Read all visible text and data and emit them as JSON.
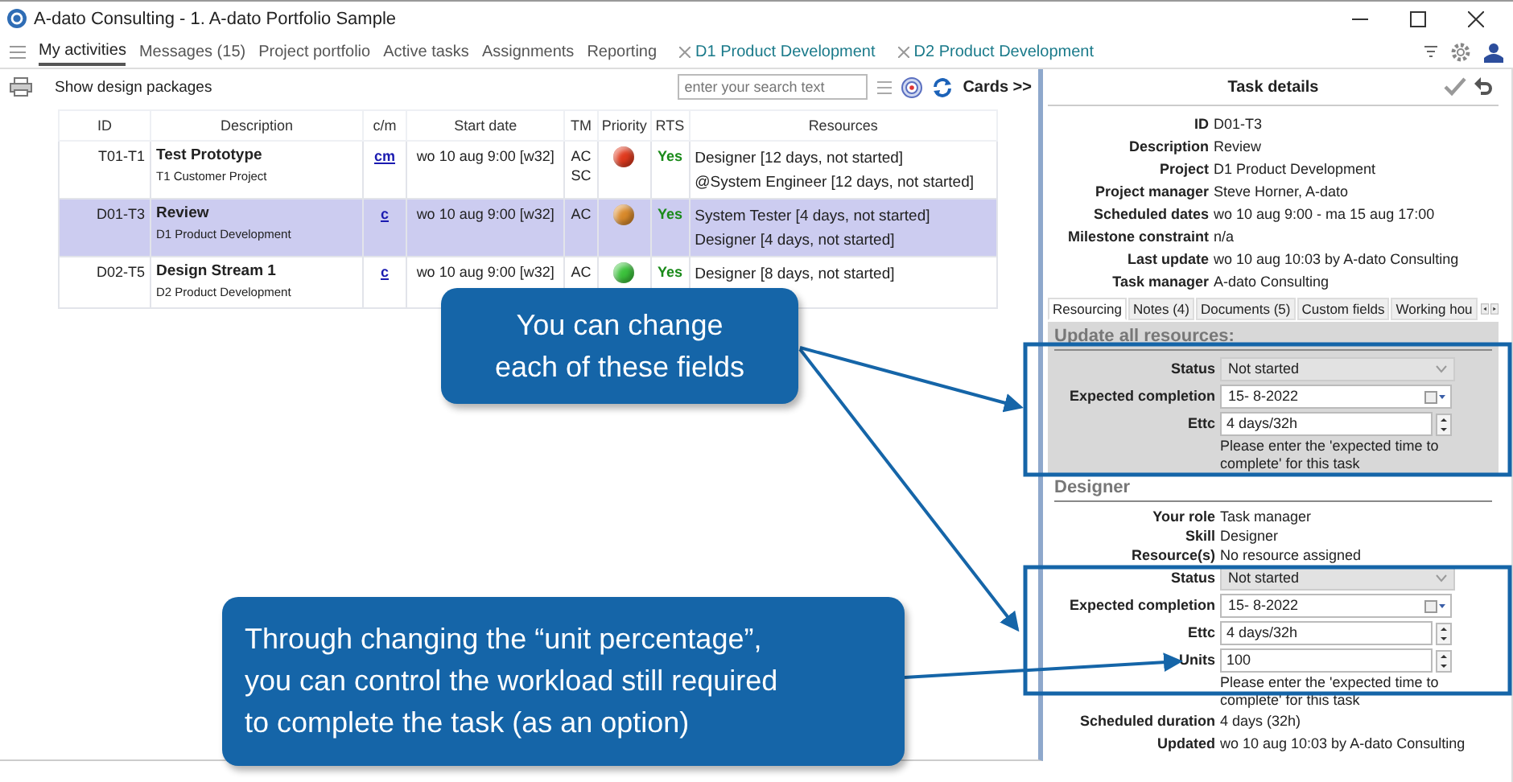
{
  "window": {
    "title": "A-dato Consulting - 1. A-dato Portfolio Sample"
  },
  "tabs": [
    {
      "label": "My activities",
      "selected": true,
      "closable": false
    },
    {
      "label": "Messages (15)",
      "selected": false,
      "closable": false
    },
    {
      "label": "Project portfolio",
      "selected": false,
      "closable": false
    },
    {
      "label": "Active tasks",
      "selected": false,
      "closable": false
    },
    {
      "label": "Assignments",
      "selected": false,
      "closable": false
    },
    {
      "label": "Reporting",
      "selected": false,
      "closable": false
    },
    {
      "label": "D1 Product Development",
      "selected": false,
      "closable": true
    },
    {
      "label": "D2  Product Development",
      "selected": false,
      "closable": true
    }
  ],
  "toolbar": {
    "show_design_packages": "Show design packages",
    "search": {
      "placeholder": "enter your search text"
    },
    "cards": "Cards >>"
  },
  "table": {
    "columns": [
      "ID",
      "Description",
      "c/m",
      "Start date",
      "TM",
      "Priority",
      "RTS",
      "Resources"
    ],
    "rows": [
      {
        "id": "T01-T1",
        "description": "Test Prototype",
        "project": "T1 Customer Project",
        "cm": "cm",
        "start": "wo 10 aug 9:00 [w32]",
        "tm": [
          "AC",
          "SC"
        ],
        "color": "#e03a1e",
        "rts": "Yes",
        "resources": [
          "Designer [12 days, not started]",
          "@System Engineer [12 days, not started]"
        ],
        "selected": false
      },
      {
        "id": "D01-T3",
        "description": "Review",
        "project": "D1 Product Development",
        "cm": "c",
        "start": "wo 10 aug 9:00 [w32]",
        "tm": [
          "AC"
        ],
        "color": "#d98a2b",
        "rts": "Yes",
        "resources": [
          "System Tester [4 days, not started]",
          "Designer [4 days, not started]"
        ],
        "selected": true
      },
      {
        "id": "D02-T5",
        "description": "Design Stream 1",
        "project": "D2  Product Development",
        "cm": "c",
        "start": "wo 10 aug 9:00 [w32]",
        "tm": [
          "AC"
        ],
        "color": "#3cc23c",
        "rts": "Yes",
        "resources": [
          "Designer [8 days, not started]"
        ],
        "selected": false
      }
    ]
  },
  "details": {
    "title": "Task details",
    "info": [
      {
        "label": "ID",
        "value": "D01-T3"
      },
      {
        "label": "Description",
        "value": "Review"
      },
      {
        "label": "Project",
        "value": "D1 Product Development"
      },
      {
        "label": "Project manager",
        "value": "Steve Horner, A-dato"
      },
      {
        "label": "Scheduled dates",
        "value": "wo 10 aug 9:00 - ma 15 aug 17:00"
      },
      {
        "label": "Milestone constraint",
        "value": "n/a"
      },
      {
        "label": "Last update",
        "value": "wo 10 aug 10:03 by A-dato Consulting"
      },
      {
        "label": "Task manager",
        "value": "A-dato Consulting"
      }
    ],
    "subtabs": [
      {
        "label": "Resourcing",
        "selected": true
      },
      {
        "label": "Notes (4)",
        "selected": false
      },
      {
        "label": "Documents (5)",
        "selected": false
      },
      {
        "label": "Custom fields",
        "selected": false
      },
      {
        "label": "Working hou",
        "selected": false
      }
    ],
    "update_all": {
      "title": "Update all resources:",
      "fields": [
        {
          "kind": "select",
          "label": "Status",
          "value": "Not started"
        },
        {
          "kind": "date",
          "label": "Expected completion",
          "value": "15-  8-2022"
        },
        {
          "kind": "spin",
          "label": "Ettc",
          "value": "4 days/32h"
        }
      ],
      "hint": "Please enter the 'expected time to complete' for this task"
    },
    "designer": {
      "title": "Designer",
      "info": [
        {
          "label": "Your role",
          "value": "Task manager"
        },
        {
          "label": "Skill",
          "value": "Designer"
        },
        {
          "label": "Resource(s)",
          "value": "No resource assigned"
        }
      ],
      "fields": [
        {
          "kind": "select",
          "label": "Status",
          "value": "Not started"
        },
        {
          "kind": "date",
          "label": "Expected completion",
          "value": "15-  8-2022"
        },
        {
          "kind": "spin",
          "label": "Ettc",
          "value": "4 days/32h"
        },
        {
          "kind": "spin",
          "label": "Units",
          "value": "100"
        }
      ],
      "hint": "Please enter the 'expected time to complete' for this task",
      "footer": [
        {
          "label": "Scheduled duration",
          "value": "4 days (32h)"
        },
        {
          "label": "Updated",
          "value": "wo 10 aug 10:03 by A-dato Consulting"
        }
      ]
    }
  },
  "callouts": [
    {
      "text": "You can change\neach of these fields"
    },
    {
      "text": "Through changing the “unit percentage”,\nyou can control the workload still required\nto complete the task (as an option)"
    }
  ]
}
